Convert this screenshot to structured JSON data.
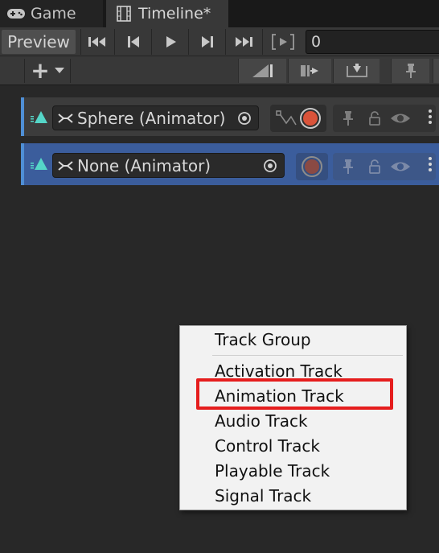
{
  "tabs": [
    {
      "label": "Game",
      "icon": "gamepad-icon"
    },
    {
      "label": "Timeline*",
      "icon": "film-strip-icon"
    }
  ],
  "toolbar": {
    "preview_label": "Preview",
    "time_value": "0",
    "add_label": "+",
    "buttons": [
      "skip-to-start-icon",
      "previous-frame-icon",
      "play-icon",
      "next-frame-icon",
      "skip-to-end-icon",
      "play-range-icon"
    ]
  },
  "tracks": [
    {
      "binding": "Sphere (Animator)",
      "selected": false
    },
    {
      "binding": "None (Animator)",
      "selected": true
    }
  ],
  "menu": {
    "items": [
      "Track Group",
      "Activation Track",
      "Animation Track",
      "Audio Track",
      "Control Track",
      "Playable Track",
      "Signal Track"
    ],
    "highlighted": "Animation Track"
  },
  "colors": {
    "accent_blue": "#4f8fd6",
    "selected_track": "#3b5d9c",
    "record_red": "#d9533a",
    "highlight_red": "#e51d1d",
    "track_teal": "#55d6c8"
  }
}
